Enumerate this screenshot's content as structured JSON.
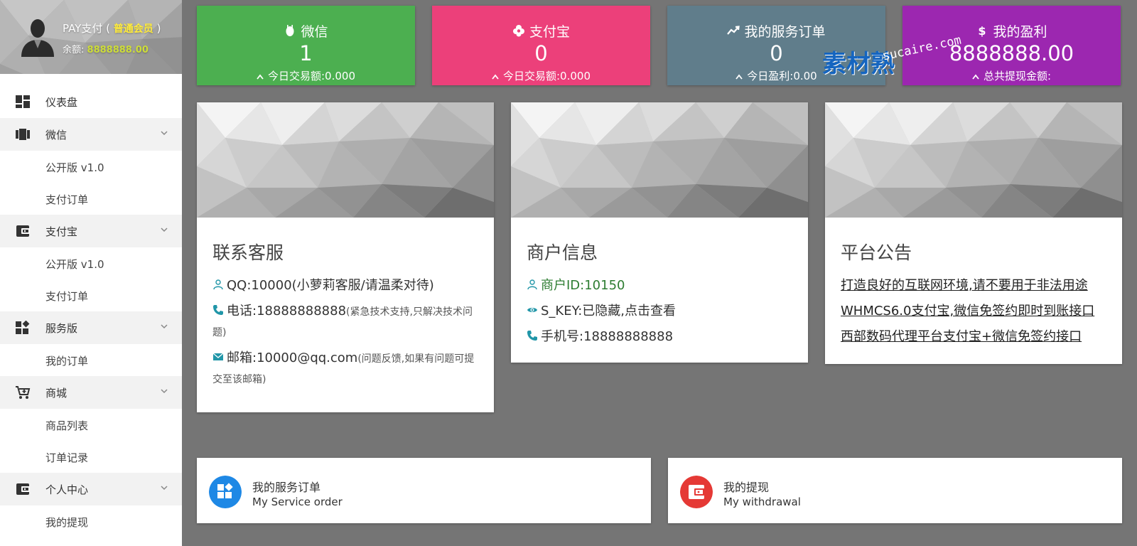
{
  "profile": {
    "name": "PAY支付",
    "paren_open": "(",
    "level": "普通会员",
    "paren_close": ")",
    "balance_label": "余额:",
    "balance_value": "8888888.00"
  },
  "sidebar": {
    "items": [
      {
        "label": "仪表盘",
        "icon": "dashboard-icon"
      },
      {
        "label": "微信",
        "icon": "wechat-icon"
      },
      {
        "label": "公开版 v1.0"
      },
      {
        "label": "支付订单"
      },
      {
        "label": "支付宝",
        "icon": "wallet-icon"
      },
      {
        "label": "公开版 v1.0"
      },
      {
        "label": "支付订单"
      },
      {
        "label": "服务版",
        "icon": "widgets-icon"
      },
      {
        "label": "我的订单"
      },
      {
        "label": "商城",
        "icon": "cart-icon"
      },
      {
        "label": "商品列表"
      },
      {
        "label": "订单记录"
      },
      {
        "label": "个人中心",
        "icon": "wallet-icon"
      },
      {
        "label": "我的提现"
      }
    ]
  },
  "stats": [
    {
      "title": "微信",
      "value": "1",
      "foot_label": "今日交易额:",
      "foot_value": "0.000",
      "color": "#4caf50",
      "icon": "wechat-icon"
    },
    {
      "title": "支付宝",
      "value": "0",
      "foot_label": "今日交易额:",
      "foot_value": "0.000",
      "color": "#ec407a",
      "icon": "alipay-icon"
    },
    {
      "title": "我的服务订单",
      "value": "0",
      "foot_label": "今日盈利:",
      "foot_value": "0.00",
      "color": "#607d8b",
      "icon": "trending-up-icon"
    },
    {
      "title": "我的盈利",
      "value": "8888888.00",
      "foot_label": "总共提现金额:",
      "foot_value": "",
      "color": "#9c27b0",
      "icon": "dollar-icon"
    }
  ],
  "contact": {
    "title": "联系客服",
    "qq": "QQ:10000(小萝莉客服/请温柔对待)",
    "phone_main": "电话:18888888888",
    "phone_note": "(紧急技术支持,只解决技术问题)",
    "email_main": "邮箱:10000@qq.com",
    "email_note": "(问题反馈,如果有问题可提交至该邮箱)"
  },
  "merchant": {
    "title": "商户信息",
    "id": "商户ID:10150",
    "skey": "S_KEY:已隐藏,点击查看",
    "mobile": "手机号:18888888888"
  },
  "notice": {
    "title": "平台公告",
    "links": [
      "打造良好的互联网环境,请不要用于非法用途",
      "WHMCS6.0支付宝,微信免签约即时到账接口",
      "西部数码代理平台支付宝+微信免签约接口"
    ]
  },
  "bottom": [
    {
      "title": "我的服务订单",
      "subtitle": "My Service order",
      "color": "#1e88e5",
      "icon": "widgets-icon"
    },
    {
      "title": "我的提现",
      "subtitle": "My withdrawal",
      "color": "#e53935",
      "icon": "wallet-icon"
    }
  ],
  "watermark": {
    "cn": "素材熟",
    "en": "sucaire.com"
  }
}
